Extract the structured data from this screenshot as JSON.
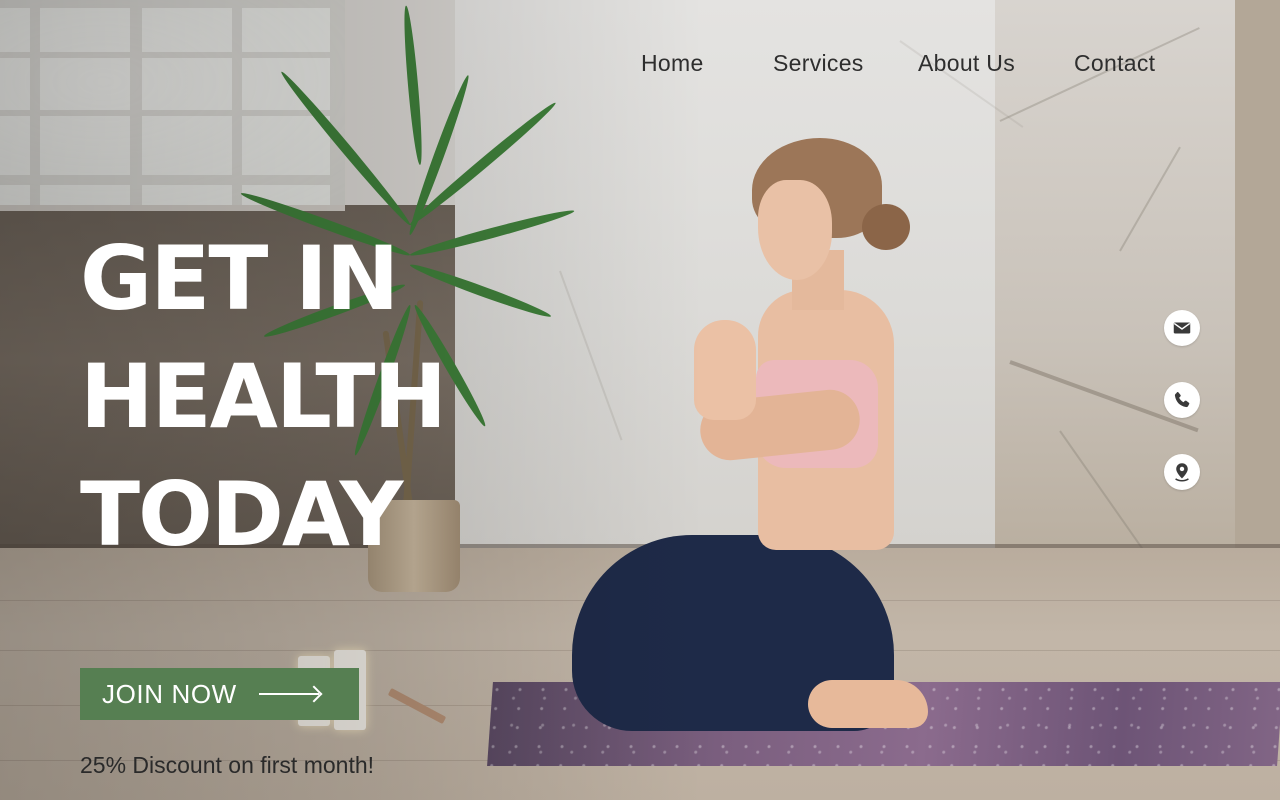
{
  "nav": {
    "items": [
      {
        "label": "Home"
      },
      {
        "label": "Services"
      },
      {
        "label": "About Us"
      },
      {
        "label": "Contact"
      }
    ]
  },
  "hero": {
    "lines": [
      "GET IN",
      "HEALTH",
      "TODAY"
    ]
  },
  "cta": {
    "label": "JOIN NOW",
    "icon": "arrow-right-icon"
  },
  "promo": {
    "text": "25% Discount on first month!"
  },
  "contact_icons": [
    "mail-icon",
    "phone-icon",
    "location-pin-icon"
  ],
  "colors": {
    "cta_background": "#567f52",
    "hero_text": "#ffffff",
    "nav_text": "#2e2e2e"
  }
}
